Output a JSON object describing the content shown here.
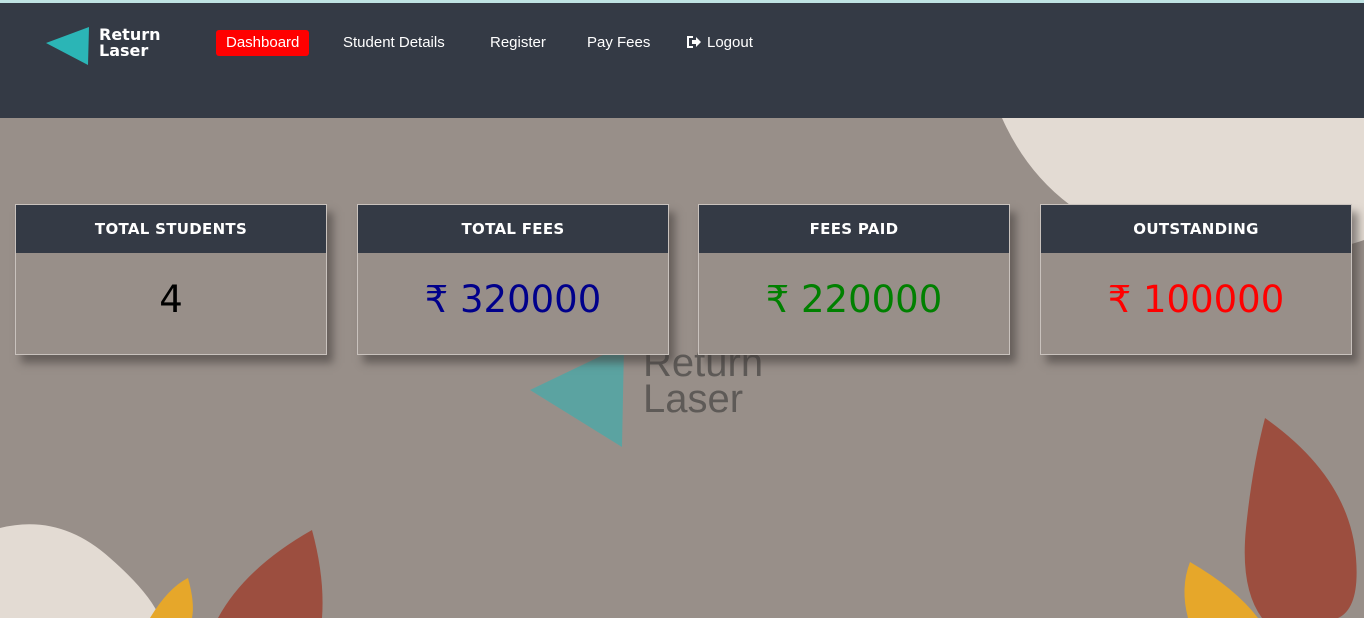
{
  "brand": {
    "line1": "Return",
    "line2": "Laser",
    "accent_color": "#2bb5b6"
  },
  "nav": {
    "items": [
      {
        "label": "Dashboard",
        "active": true
      },
      {
        "label": "Student Details",
        "active": false
      },
      {
        "label": "Register",
        "active": false
      },
      {
        "label": "Pay Fees",
        "active": false
      },
      {
        "label": "Logout",
        "active": false,
        "icon": "sign-out-icon"
      }
    ],
    "active_color": "#ff0000",
    "bar_color": "#343a45"
  },
  "cards": [
    {
      "title": "TOTAL STUDENTS",
      "value": "4",
      "value_color": "#000000"
    },
    {
      "title": "TOTAL FEES",
      "value": "₹ 320000",
      "value_color": "#00008b"
    },
    {
      "title": "FEES PAID",
      "value": "₹ 220000",
      "value_color": "#008000"
    },
    {
      "title": "OUTSTANDING",
      "value": "₹ 100000",
      "value_color": "#ff0000"
    }
  ],
  "watermark": {
    "line1": "Return",
    "line2": "Laser"
  }
}
